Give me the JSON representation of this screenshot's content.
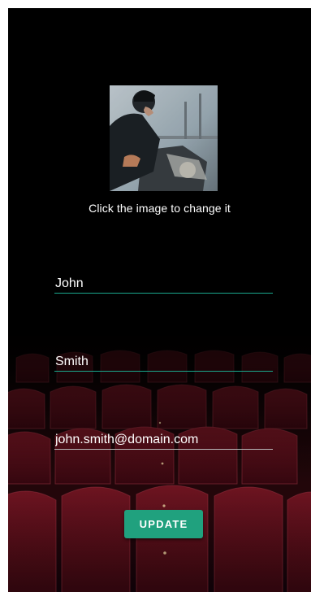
{
  "profile": {
    "image_hint": "Click the image to change it",
    "first_name": "John",
    "last_name": "Smith",
    "email": "john.smith@domain.com",
    "update_label": "UPDATE"
  },
  "colors": {
    "accent": "#20a17e",
    "field_underline_active": "#1aa88d",
    "field_underline_inactive": "#b9b9b9",
    "background": "#000000"
  }
}
